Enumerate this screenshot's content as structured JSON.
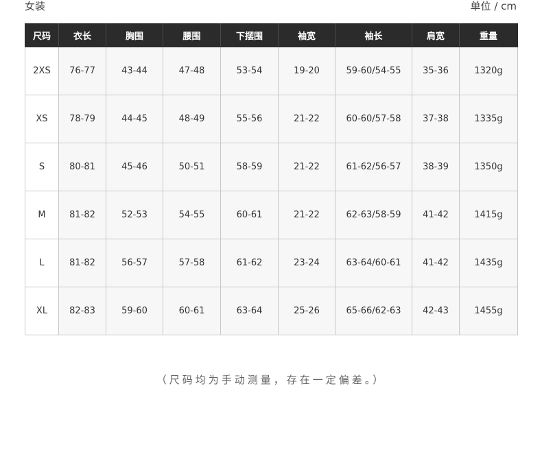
{
  "header": {
    "category": "女装",
    "unit": "单位 / cm"
  },
  "table": {
    "columns": [
      "尺码",
      "衣长",
      "胸围",
      "腰围",
      "下摆围",
      "袖宽",
      "袖长",
      "肩宽",
      "重量"
    ],
    "rows": [
      [
        "2XS",
        "76-77",
        "43-44",
        "47-48",
        "53-54",
        "19-20",
        "59-60/54-55",
        "35-36",
        "1320g"
      ],
      [
        "XS",
        "78-79",
        "44-45",
        "48-49",
        "55-56",
        "21-22",
        "60-60/57-58",
        "37-38",
        "1335g"
      ],
      [
        "S",
        "80-81",
        "45-46",
        "50-51",
        "58-59",
        "21-22",
        "61-62/56-57",
        "38-39",
        "1350g"
      ],
      [
        "M",
        "81-82",
        "52-53",
        "54-55",
        "60-61",
        "21-22",
        "62-63/58-59",
        "41-42",
        "1415g"
      ],
      [
        "L",
        "81-82",
        "56-57",
        "57-58",
        "61-62",
        "23-24",
        "63-64/60-61",
        "41-42",
        "1435g"
      ],
      [
        "XL",
        "82-83",
        "59-60",
        "60-61",
        "63-64",
        "25-26",
        "65-66/62-63",
        "42-43",
        "1455g"
      ]
    ]
  },
  "footer": {
    "note": "（尺码均为手动测量，存在一定偏差。）"
  },
  "colors": {
    "header_bg": "#2b2b2b",
    "header_text": "#ffffff",
    "cell_bg": "#f7f7f7",
    "border": "#c8c8c8"
  }
}
